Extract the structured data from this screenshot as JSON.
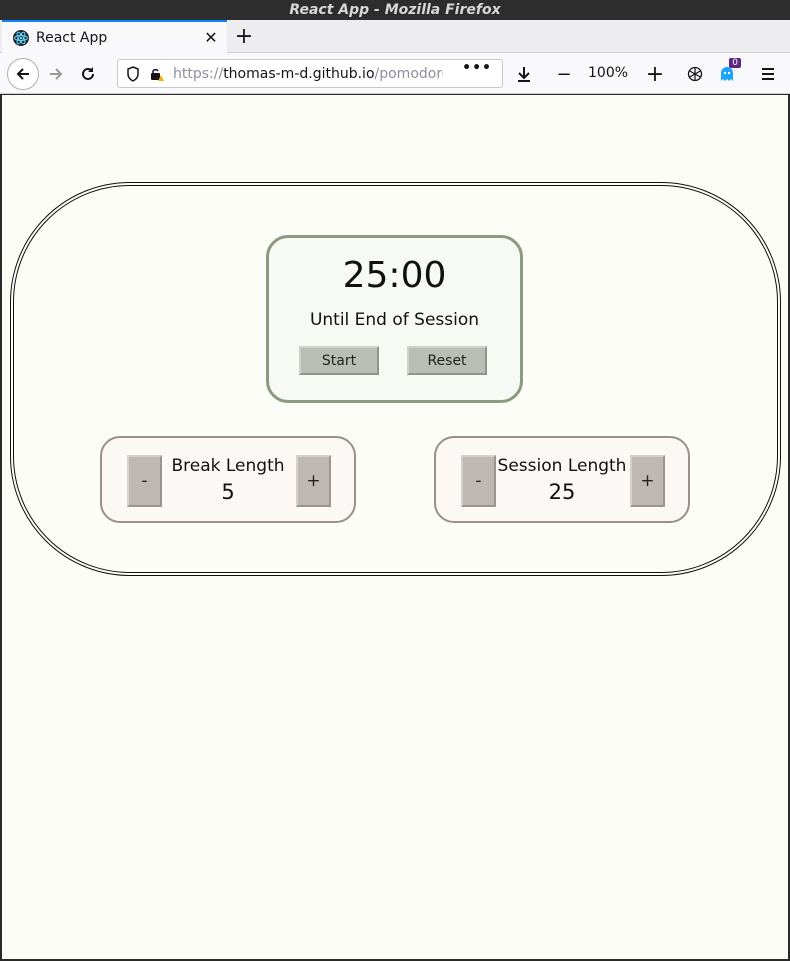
{
  "window": {
    "title": "React App - Mozilla Firefox"
  },
  "tabs": [
    {
      "title": "React App",
      "favicon": "react-icon",
      "close_glyph": "✕"
    }
  ],
  "new_tab_glyph": "+",
  "navbar": {
    "url_scheme": "https://",
    "url_host": "thomas-m-d.github.io",
    "url_path": "/pomodoro",
    "zoom": "100%",
    "zoom_out": "−",
    "zoom_in": "+",
    "extension_badge": "0"
  },
  "timer": {
    "time": "25:00",
    "label": "Until End of Session",
    "start_label": "Start",
    "reset_label": "Reset"
  },
  "break": {
    "label": "Break Length",
    "value": "5",
    "decrement": "-",
    "increment": "+"
  },
  "session": {
    "label": "Session Length",
    "value": "25",
    "decrement": "-",
    "increment": "+"
  },
  "colors": {
    "page_bg": "#fcfdf7",
    "timer_border": "#8c9a80",
    "length_border": "#9a8f8c",
    "tab_accent": "#0a84ff"
  }
}
